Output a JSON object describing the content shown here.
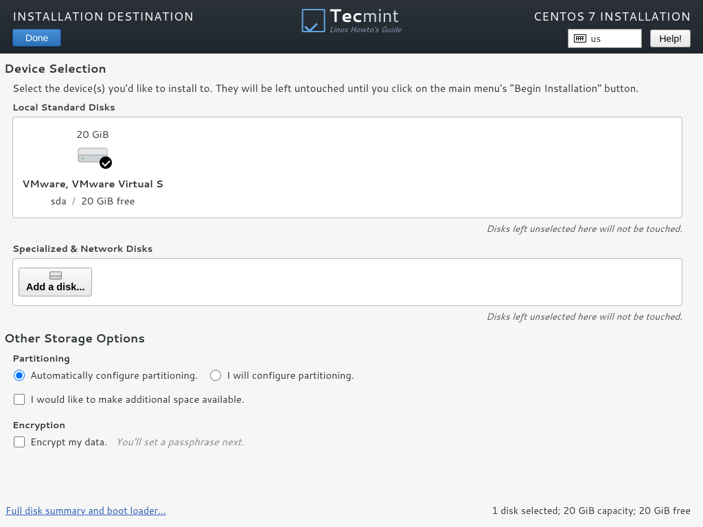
{
  "header": {
    "page_title": "INSTALLATION DESTINATION",
    "done_label": "Done",
    "install_title": "CENTOS 7 INSTALLATION",
    "keyboard_layout": "us",
    "help_label": "Help!",
    "brand_main_a": "Tec",
    "brand_main_b": "mint",
    "brand_sub": "Linux Howto's Guide"
  },
  "device_selection": {
    "title": "Device Selection",
    "instruction": "Select the device(s) you'd like to install to.  They will be left untouched until you click on the main menu's \"Begin Installation\" button.",
    "local_label": "Local Standard Disks",
    "disk": {
      "size": "20 GiB",
      "name": "VMware, VMware Virtual S",
      "dev": "sda",
      "free": "20 GiB free"
    },
    "hint": "Disks left unselected here will not be touched.",
    "net_label": "Specialized & Network Disks",
    "add_disk_label": "Add a disk..."
  },
  "storage": {
    "title": "Other Storage Options",
    "partitioning_label": "Partitioning",
    "auto_label": "Automatically configure partitioning.",
    "manual_label": "I will configure partitioning.",
    "space_label": "I would like to make additional space available.",
    "encryption_label": "Encryption",
    "encrypt_label": "Encrypt my data.",
    "encrypt_hint": "You'll set a passphrase next."
  },
  "footer": {
    "link": "Full disk summary and boot loader...",
    "summary": "1 disk selected; 20 GiB capacity; 20 GiB free"
  }
}
